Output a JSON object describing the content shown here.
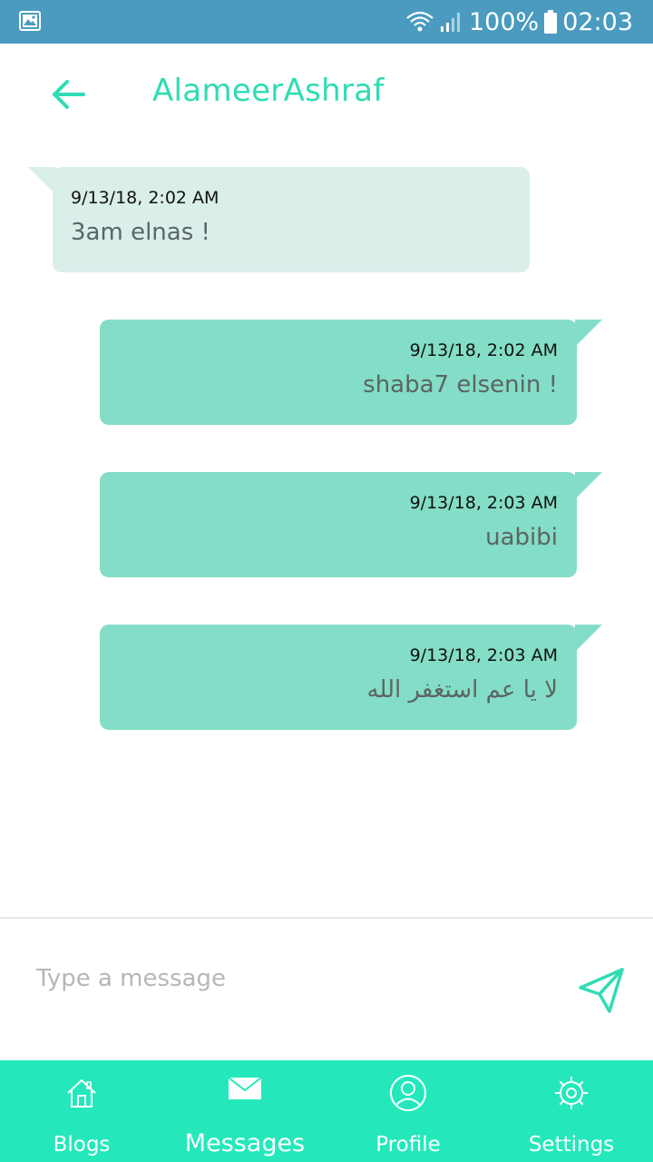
{
  "status_bar": {
    "battery": "100%",
    "time": "02:03"
  },
  "header": {
    "title": "AlameerAshraf"
  },
  "messages": [
    {
      "direction": "received",
      "time": "9/13/18, 2:02 AM",
      "text": "3am elnas !"
    },
    {
      "direction": "sent",
      "time": "9/13/18, 2:02 AM",
      "text": "shaba7 elsenin !"
    },
    {
      "direction": "sent",
      "time": "9/13/18, 2:03 AM",
      "text": "uabibi"
    },
    {
      "direction": "sent",
      "time": "9/13/18, 2:03 AM",
      "text": "لا يا عم استغفر الله"
    }
  ],
  "composer": {
    "placeholder": "Type a message",
    "value": ""
  },
  "bottom_nav": {
    "items": [
      {
        "label": "Blogs",
        "icon": "home-icon",
        "active": false
      },
      {
        "label": "Messages",
        "icon": "envelope-icon",
        "active": true
      },
      {
        "label": "Profile",
        "icon": "user-icon",
        "active": false
      },
      {
        "label": "Settings",
        "icon": "gear-icon",
        "active": false
      }
    ]
  },
  "colors": {
    "status_bar": "#4a9bbf",
    "accent": "#2fdcb4",
    "received_bubble": "#daeeea",
    "sent_bubble": "#84ddc6",
    "nav_bar": "#24e8bb"
  }
}
